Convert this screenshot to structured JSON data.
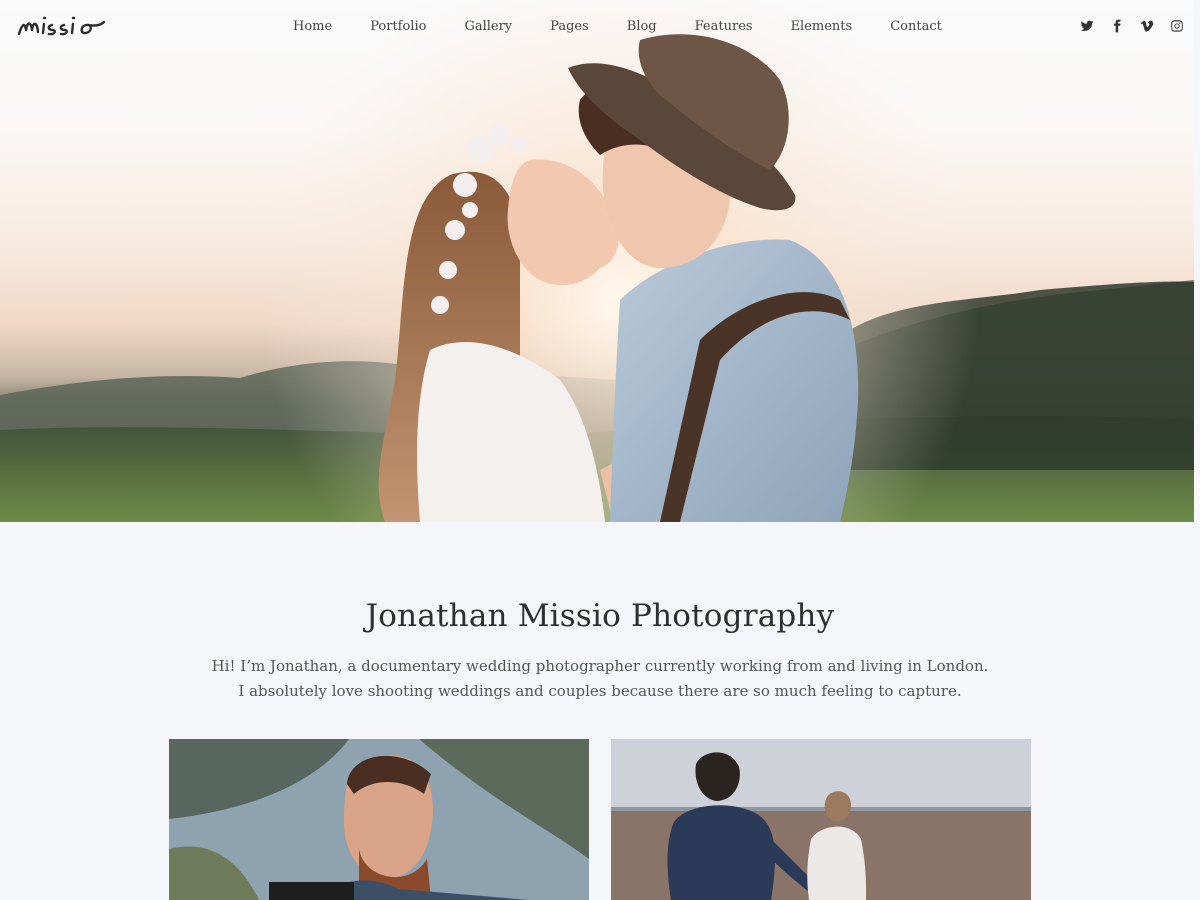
{
  "brand": {
    "logo_text": "missio"
  },
  "nav": {
    "items": [
      "Home",
      "Portfolio",
      "Gallery",
      "Pages",
      "Blog",
      "Features",
      "Elements",
      "Contact"
    ]
  },
  "social": {
    "icons": [
      "twitter-icon",
      "facebook-icon",
      "vimeo-icon",
      "instagram-icon"
    ]
  },
  "intro": {
    "title": "Jonathan Missio Photography",
    "line1": "Hi! I’m Jonathan, a documentary wedding photographer currently working from and living in London.",
    "line2": "I absolutely love shooting weddings and couples because there are so much feeling to capture."
  },
  "colors": {
    "background": "#f5f6fa",
    "text": "#333333",
    "nav_text": "#444444"
  }
}
